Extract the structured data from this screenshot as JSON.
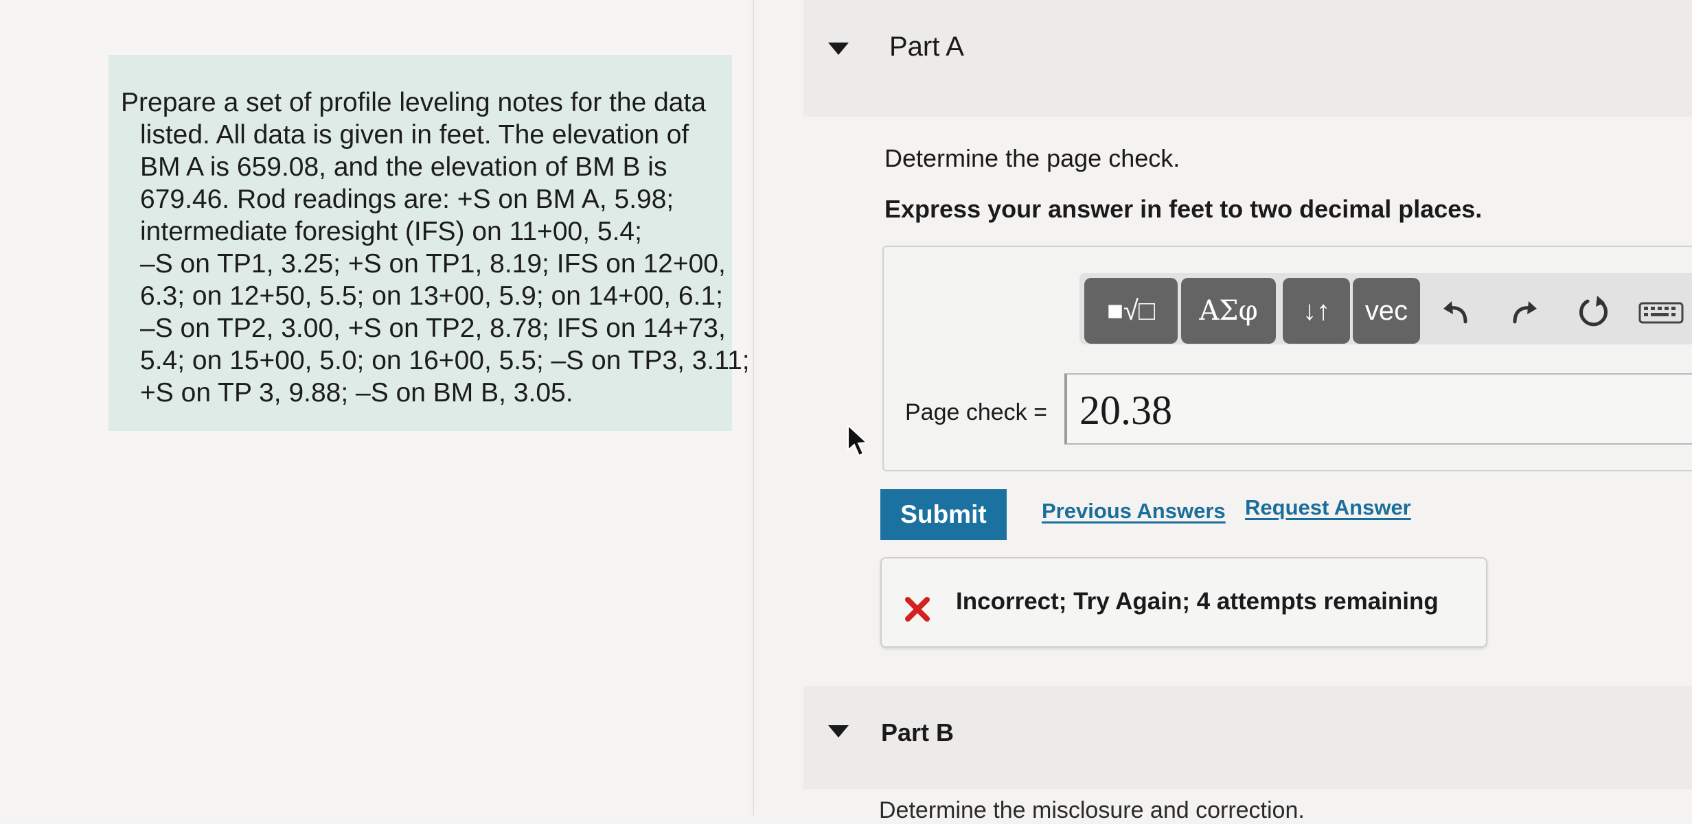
{
  "problem": {
    "lines": [
      "Prepare a set of profile leveling notes for the data",
      "listed. All data is given in feet. The elevation of",
      "BM A is 659.08, and the elevation of BM B is",
      "679.46. Rod readings are: +S on BM A, 5.98;",
      "intermediate foresight (IFS) on 11+00, 5.4;",
      "–S on TP1, 3.25; +S on TP1, 8.19; IFS on 12+00,",
      "6.3; on 12+50, 5.5; on 13+00, 5.9; on 14+00, 6.1;",
      "–S on TP2, 3.00, +S on TP2, 8.78; IFS on 14+73,",
      "5.4; on 15+00, 5.0; on 16+00, 5.5; –S on TP3, 3.11;",
      "+S on TP 3, 9.88; –S on BM B, 3.05."
    ]
  },
  "part_a": {
    "title": "Part A",
    "question": "Determine the page check.",
    "instruction": "Express your answer in feet to two decimal places.",
    "toolbar": {
      "templates_label": "■√□",
      "greek_label": "ΑΣφ",
      "arrows_label": "↓↑",
      "vector_label": "vec",
      "undo_icon": "undo-icon",
      "redo_icon": "redo-icon",
      "reset_icon": "reset-icon",
      "keyboard_icon": "keyboard-icon"
    },
    "answer_label": "Page check =",
    "answer_value": "20.38",
    "submit_label": "Submit",
    "previous_answers_label": "Previous Answers",
    "request_answer_label": "Request Answer",
    "feedback": "Incorrect; Try Again; 4 attempts remaining"
  },
  "part_b": {
    "title": "Part B",
    "question": "Determine the misclosure and correction."
  },
  "colors": {
    "accent": "#1b72a0",
    "link": "#1a6e9b",
    "error": "#d42020",
    "problem_bg": "#deebe7"
  }
}
